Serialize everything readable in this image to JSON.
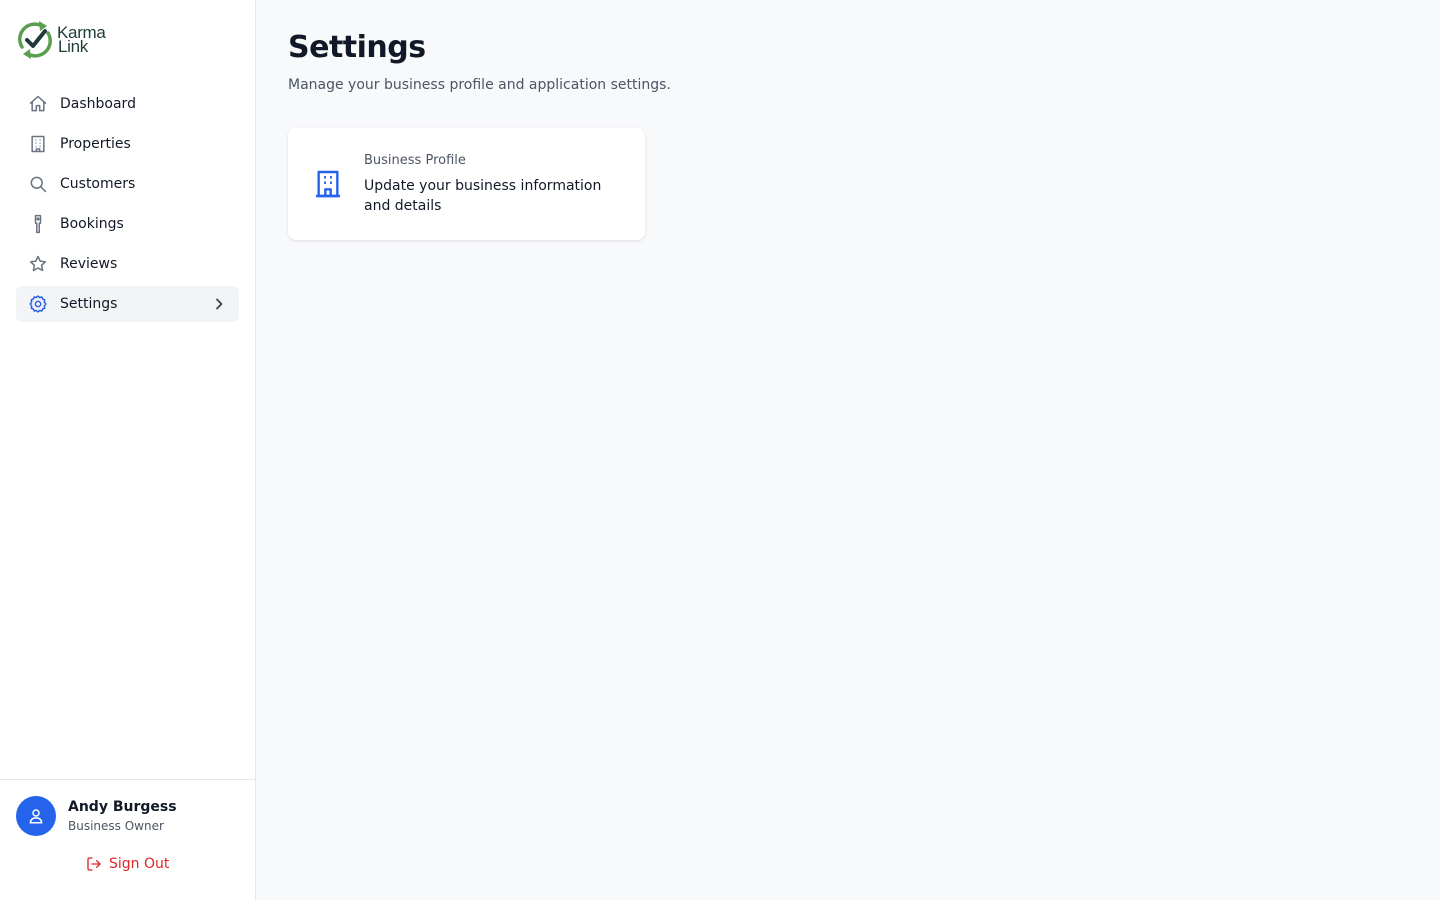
{
  "app": {
    "brand": {
      "line1": "Karma",
      "line2": "Link",
      "colors": {
        "arrow": "#5a9e4f",
        "check": "#1f3b3a"
      }
    }
  },
  "sidebar": {
    "items": [
      {
        "label": "Dashboard",
        "icon": "home-icon",
        "active": false
      },
      {
        "label": "Properties",
        "icon": "building-icon",
        "active": false
      },
      {
        "label": "Customers",
        "icon": "search-icon",
        "active": false
      },
      {
        "label": "Bookings",
        "icon": "booking-tag-icon",
        "active": false
      },
      {
        "label": "Reviews",
        "icon": "star-icon",
        "active": false
      },
      {
        "label": "Settings",
        "icon": "gear-icon",
        "active": true
      }
    ],
    "user": {
      "name": "Andy Burgess",
      "role": "Business Owner",
      "avatar_icon": "user-icon"
    },
    "signout_label": "Sign Out"
  },
  "main": {
    "title": "Settings",
    "subtitle": "Manage your business profile and application settings.",
    "cards": [
      {
        "title": "Business Profile",
        "description": "Update your business information and details",
        "icon": "office-building-icon"
      }
    ]
  },
  "colors": {
    "accent": "#2563eb",
    "danger": "#dc2626",
    "background": "#f8f9fb",
    "sidebar_bg": "#ffffff",
    "active_bg": "#f3f4f6"
  }
}
